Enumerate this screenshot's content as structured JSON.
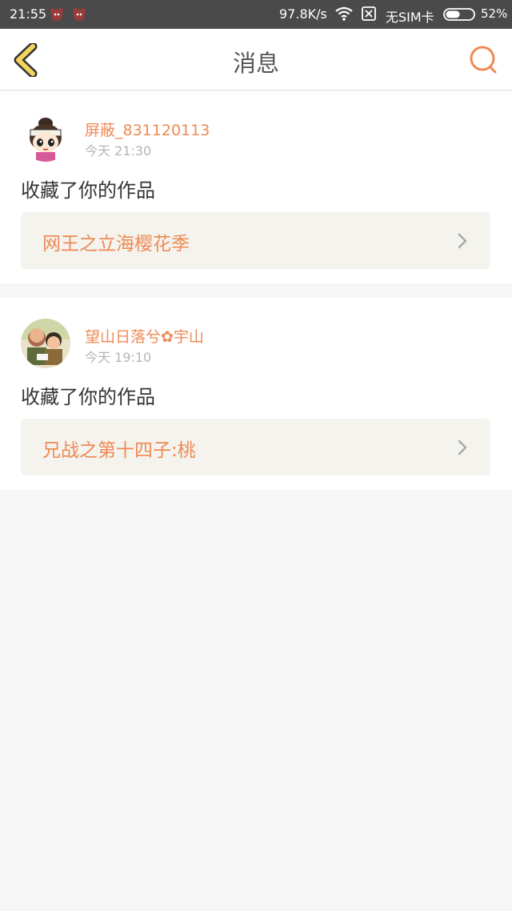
{
  "status_bar": {
    "time": "21:55",
    "network_speed": "97.8K/s",
    "sim_status": "无SIM卡",
    "battery_percent": "52%",
    "battery_level": 0.52
  },
  "header": {
    "title": "消息"
  },
  "notifications": [
    {
      "username": "屏蔽_831120113",
      "time": "今天 21:30",
      "action": "收藏了你的作品",
      "work_title": "网王之立海樱花季"
    },
    {
      "username": "望山日落兮✿宇山",
      "time": "今天 19:10",
      "action": "收藏了你的作品",
      "work_title": "兄战之第十四子:桃"
    }
  ],
  "colors": {
    "accent": "#ee8a55",
    "status_bar": "#4a4a4a",
    "card_link_bg": "#f4f3ee",
    "page_bg": "#f6f6f6"
  },
  "icons": {
    "back": "chevron-left-icon",
    "search": "search-icon",
    "row_arrow": "chevron-right-icon"
  }
}
